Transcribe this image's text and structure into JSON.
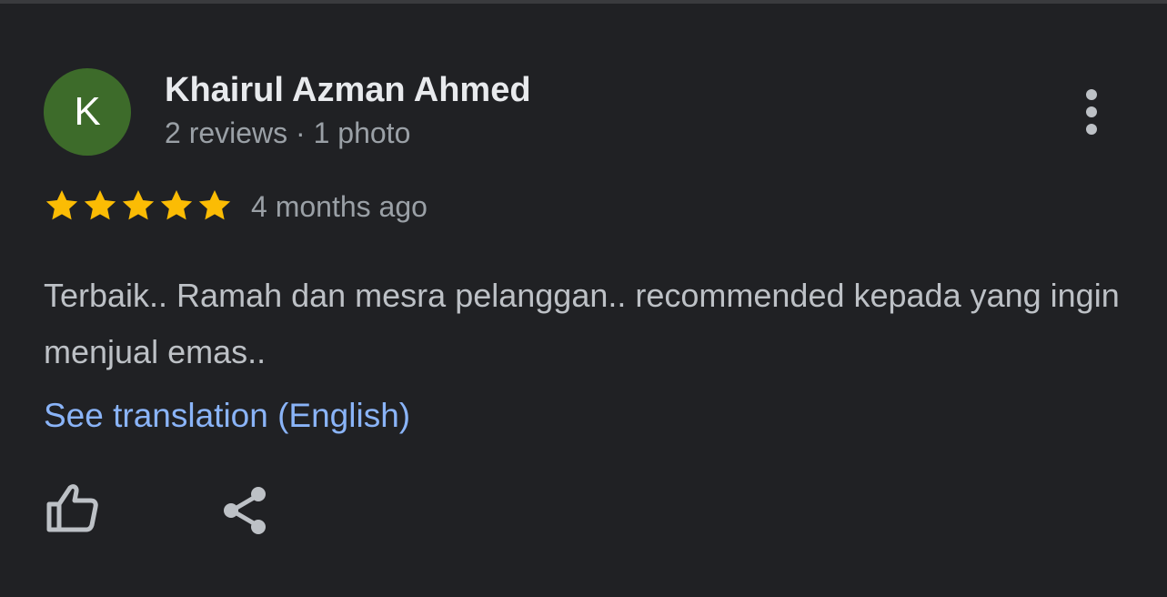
{
  "review": {
    "author": {
      "initial": "K",
      "name": "Khairul Azman Ahmed",
      "meta": "2 reviews · 1 photo",
      "avatar_color": "#3d6b2a"
    },
    "rating": {
      "value": 5,
      "max": 5,
      "star_color": "#fbbc04"
    },
    "time_ago": "4 months ago",
    "text": "Terbaik.. Ramah dan mesra pelanggan.. recommended kepada yang ingin menjual emas..",
    "translation_link": "See translation (English)",
    "actions": {
      "like_icon": "thumbs-up-icon",
      "share_icon": "share-icon",
      "more_icon": "more-vert-icon"
    }
  },
  "colors": {
    "background": "#202124",
    "link": "#8ab4f8",
    "primary_text": "#e8eaed",
    "secondary_text": "#9aa0a6"
  }
}
